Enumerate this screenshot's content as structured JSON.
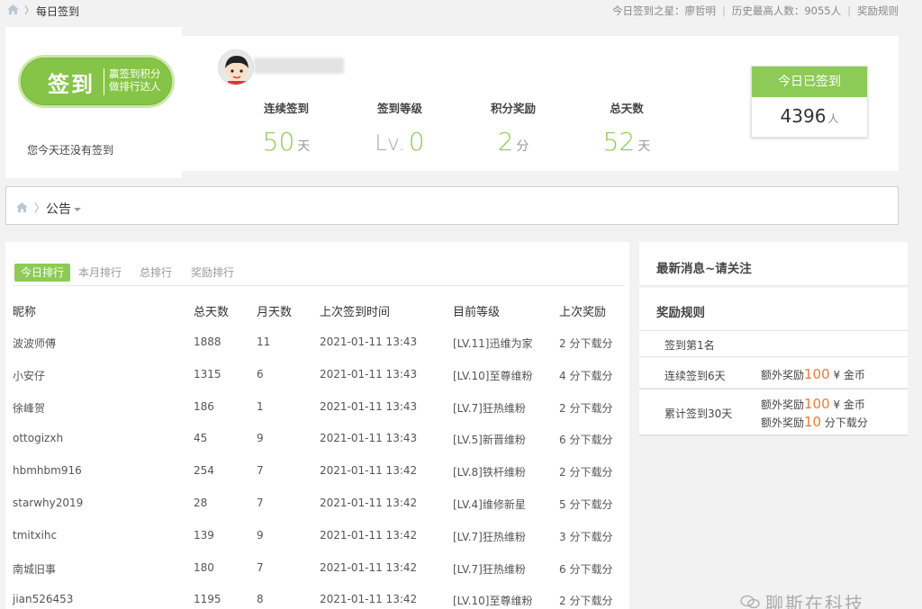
{
  "topbar": {
    "crumb": "每日签到",
    "star_label": "今日签到之星：廖哲明",
    "history_label": "历史最高人数：9055人",
    "rules_link": "奖励规则"
  },
  "sign": {
    "button_big": "签到",
    "button_line1": "赢签到积分",
    "button_line2": "做排行达人",
    "status": "您今天还没有签到"
  },
  "stats": [
    {
      "label": "连续签到",
      "prefix": "",
      "value": "50",
      "unit": "天"
    },
    {
      "label": "签到等级",
      "prefix": "Lv.",
      "value": "0",
      "unit": ""
    },
    {
      "label": "积分奖励",
      "prefix": "",
      "value": "2",
      "unit": "分"
    },
    {
      "label": "总天数",
      "prefix": "",
      "value": "52",
      "unit": "天"
    }
  ],
  "today_box": {
    "title": "今日已签到",
    "count": "4396",
    "unit": "人"
  },
  "notice": {
    "title": "公告"
  },
  "tabs": [
    "今日排行",
    "本月排行",
    "总排行",
    "奖励排行"
  ],
  "table": {
    "headers": [
      "昵称",
      "总天数",
      "月天数",
      "上次签到时间",
      "目前等级",
      "上次奖励"
    ],
    "rows": [
      [
        "波波师傅",
        "1888",
        "11",
        "2021-01-11 13:43",
        "[LV.11]迅维为家",
        "2 分下载分"
      ],
      [
        "小安仔",
        "1315",
        "6",
        "2021-01-11 13:43",
        "[LV.10]至尊维粉",
        "4 分下载分"
      ],
      [
        "徐峰贺",
        "186",
        "1",
        "2021-01-11 13:43",
        "[LV.7]狂热维粉",
        "2 分下载分"
      ],
      [
        "ottogizxh",
        "45",
        "9",
        "2021-01-11 13:43",
        "[LV.5]新晋维粉",
        "6 分下载分"
      ],
      [
        "hbmhbm916",
        "254",
        "7",
        "2021-01-11 13:42",
        "[LV.8]铁杆维粉",
        "2 分下载分"
      ],
      [
        "starwhy2019",
        "28",
        "7",
        "2021-01-11 13:42",
        "[LV.4]维修新星",
        "5 分下载分"
      ],
      [
        "tmitxihc",
        "139",
        "9",
        "2021-01-11 13:42",
        "[LV.7]狂热维粉",
        "3 分下载分"
      ],
      [
        "南城旧事",
        "180",
        "7",
        "2021-01-11 13:42",
        "[LV.7]狂热维粉",
        "6 分下载分"
      ],
      [
        "jian526453",
        "1195",
        "8",
        "2021-01-11 13:42",
        "[LV.10]至尊维粉",
        "2 分下载分"
      ]
    ]
  },
  "news": {
    "title": "最新消息~请关注"
  },
  "rules": {
    "title": "奖励规则",
    "rows": [
      {
        "name": "签到第1名"
      },
      {
        "name": "连续签到6天",
        "rewards": [
          {
            "pre": "额外奖励",
            "num": "100",
            "post": " ¥ 金币"
          }
        ]
      },
      {
        "name": "累计签到30天",
        "rewards": [
          {
            "pre": "额外奖励",
            "num": "100",
            "post": " ¥ 金币"
          },
          {
            "pre": "额外奖励",
            "num": "10",
            "post": " 分下载分"
          }
        ]
      }
    ]
  },
  "watermark": "聊斯在科技",
  "colors": {
    "accent": "#8ccb55",
    "orange": "#e67b3c"
  }
}
